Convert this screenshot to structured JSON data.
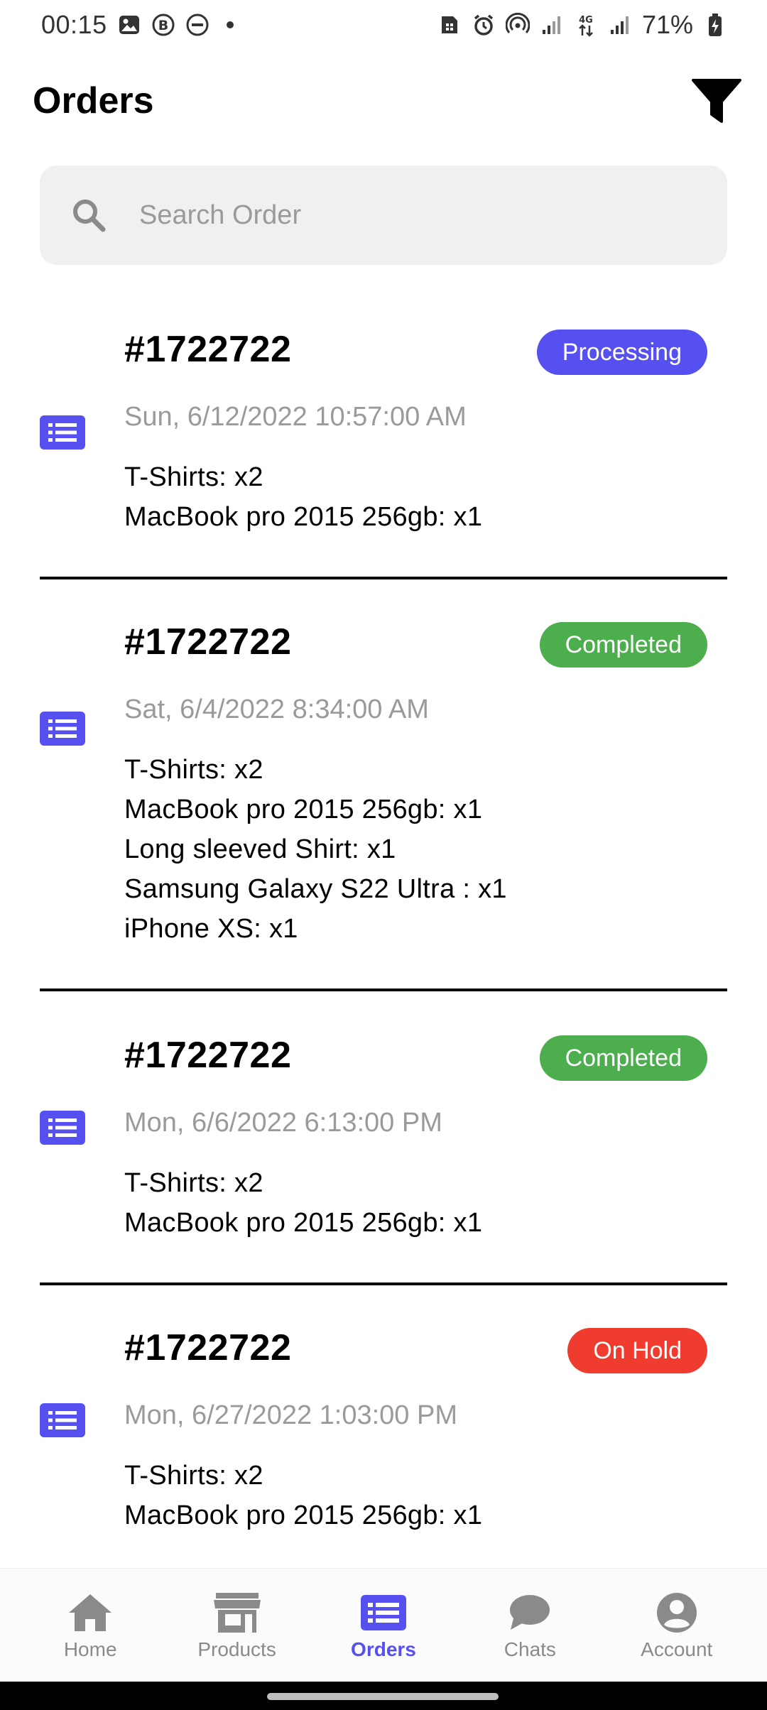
{
  "status_bar": {
    "time": "00:15",
    "battery_percent": "71%"
  },
  "header": {
    "title": "Orders"
  },
  "search": {
    "placeholder": "Search Order",
    "value": ""
  },
  "colors": {
    "accent": "#5750f1",
    "processing": "#5750f1",
    "completed": "#4cae4c",
    "on_hold": "#f03c2e"
  },
  "orders": [
    {
      "number": "#1722722",
      "status": "Processing",
      "date": "Sun, 6/12/2022 10:57:00 AM",
      "items": [
        "T-Shirts: x2",
        "MacBook pro 2015 256gb: x1"
      ]
    },
    {
      "number": "#1722722",
      "status": "Completed",
      "date": "Sat, 6/4/2022 8:34:00 AM",
      "items": [
        "T-Shirts: x2",
        "MacBook pro 2015 256gb: x1",
        "Long sleeved Shirt: x1",
        "Samsung Galaxy S22 Ultra : x1",
        "iPhone XS: x1"
      ]
    },
    {
      "number": "#1722722",
      "status": "Completed",
      "date": "Mon, 6/6/2022 6:13:00 PM",
      "items": [
        "T-Shirts: x2",
        "MacBook pro 2015 256gb: x1"
      ]
    },
    {
      "number": "#1722722",
      "status": "On Hold",
      "date": "Mon, 6/27/2022 1:03:00 PM",
      "items": [
        "T-Shirts: x2",
        "MacBook pro 2015 256gb: x1"
      ]
    }
  ],
  "bottom_nav": {
    "items": [
      {
        "label": "Home",
        "icon": "home-icon"
      },
      {
        "label": "Products",
        "icon": "store-icon"
      },
      {
        "label": "Orders",
        "icon": "list-icon",
        "active": true
      },
      {
        "label": "Chats",
        "icon": "chat-bubble-icon"
      },
      {
        "label": "Account",
        "icon": "account-icon"
      }
    ]
  }
}
